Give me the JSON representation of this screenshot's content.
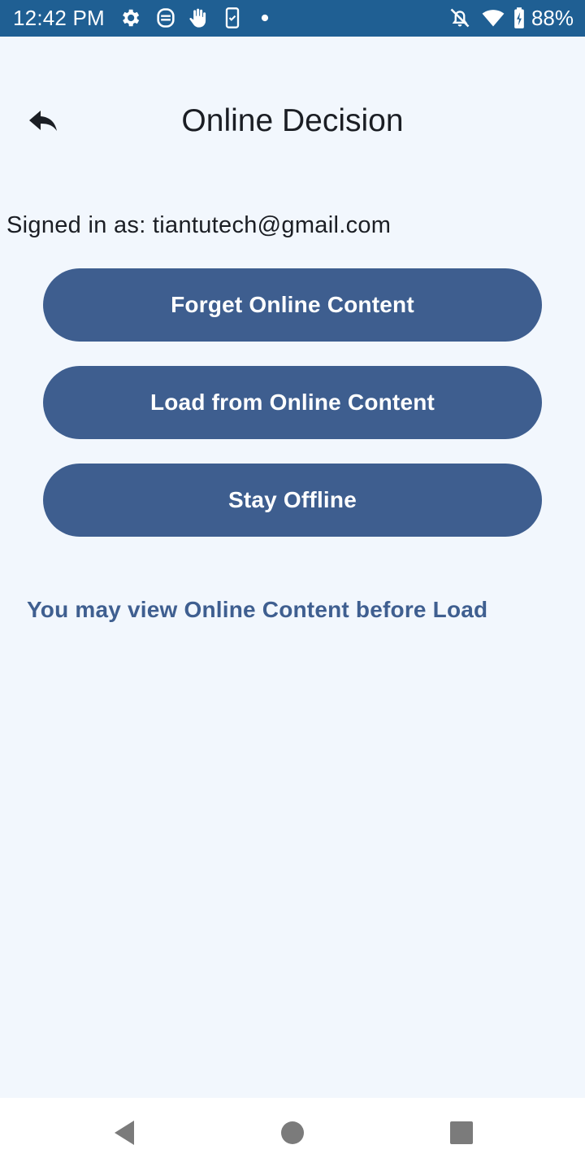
{
  "status_bar": {
    "time": "12:42 PM",
    "battery": "88%",
    "icons": [
      "gear-icon",
      "accessibility-icon",
      "hand-icon",
      "phone-icon",
      "dot-icon",
      "bell-off-icon",
      "wifi-icon",
      "battery-charging-icon"
    ]
  },
  "header": {
    "title": "Online Decision",
    "back_icon": "reply-arrow-icon"
  },
  "account": {
    "signed_in_text": "Signed in as: tiantutech@gmail.com"
  },
  "buttons": {
    "forget": "Forget Online Content",
    "load": "Load from Online Content",
    "offline": "Stay Offline"
  },
  "hint": "You may view Online Content before Load",
  "nav_bar": {
    "icons": [
      "back-triangle-icon",
      "home-circle-icon",
      "recents-square-icon"
    ]
  },
  "colors": {
    "status_bar": "#1f5f93",
    "background": "#f2f7fd",
    "button": "#3e5e8f",
    "hint_text": "#3f5f90"
  }
}
